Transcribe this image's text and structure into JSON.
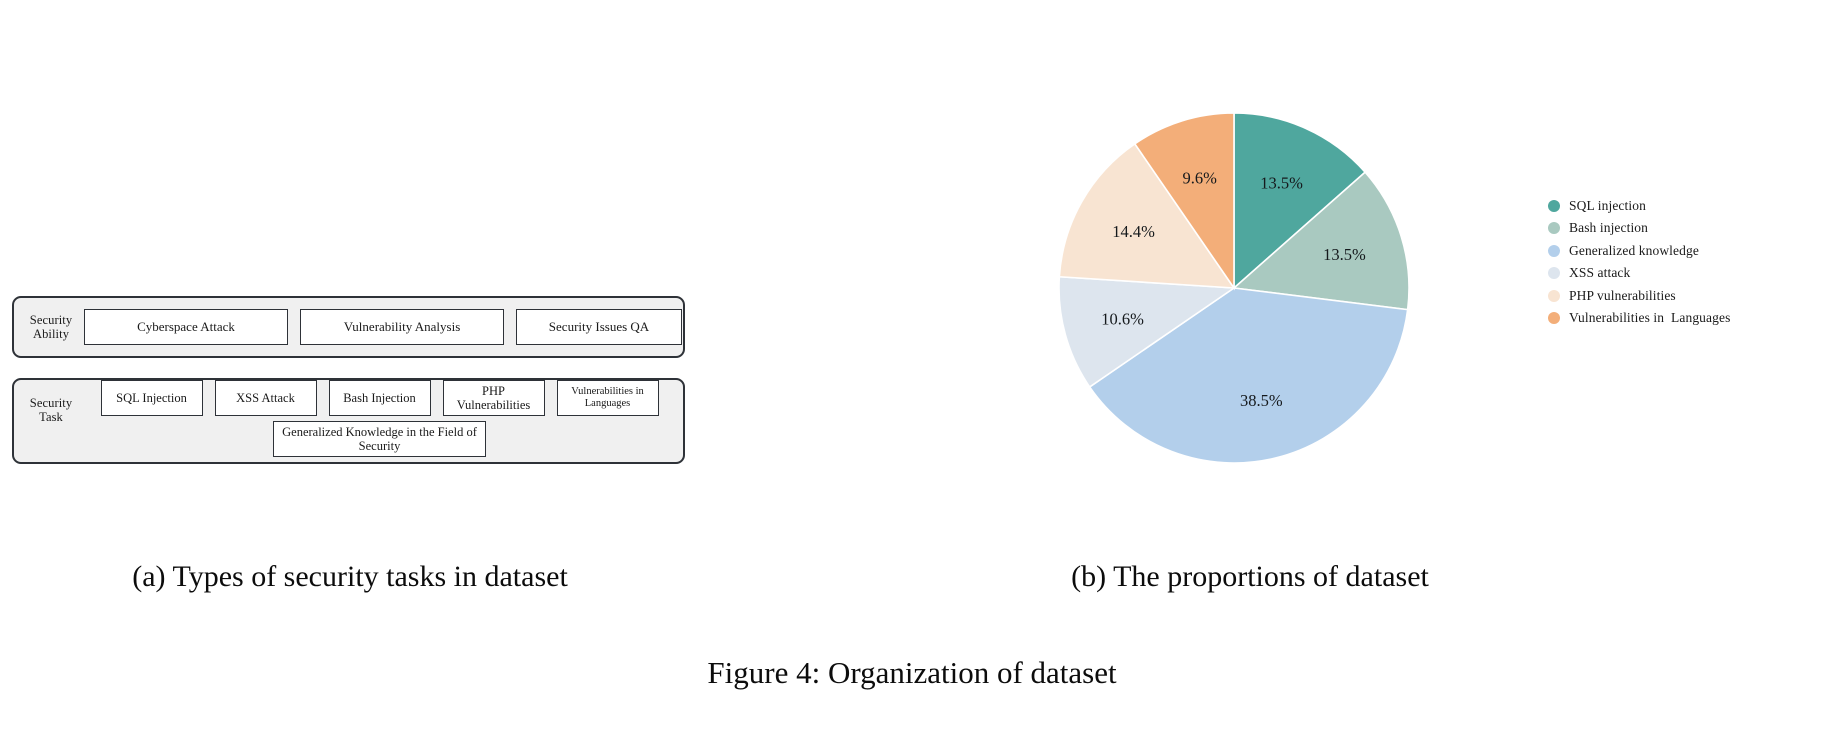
{
  "figure": {
    "caption": "Figure 4: Organization of dataset",
    "subcaption_a": "(a) Types of security tasks in dataset",
    "subcaption_b": "(b) The proportions of dataset"
  },
  "diagram": {
    "groups": [
      {
        "label": "Security\nAbility",
        "label_line1": "Security",
        "label_line2": "Ability",
        "items": [
          "Cyberspace Attack",
          "Vulnerability Analysis",
          "Security Issues QA"
        ]
      },
      {
        "label": "Security\nTask",
        "label_line1": "Security",
        "label_line2": "Task",
        "items": [
          "SQL Injection",
          "XSS Attack",
          "Bash Injection",
          "PHP\nVulnerabilities",
          "Vulnerabilities in\nLanguages",
          "Generalized Knowledge in the\nField of Security"
        ],
        "items_row1": [
          "SQL Injection",
          "XSS Attack",
          "Bash Injection",
          "PHP Vulnerabilities",
          "Vulnerabilities in Languages"
        ],
        "items_row2": [
          "Generalized Knowledge in the Field of Security"
        ]
      }
    ],
    "colors": {
      "panel_background": "#f0f0f0",
      "panel_border": "#2e3238",
      "box_background": "#ffffff",
      "box_border": "#2e3238",
      "text": "#1a1a1a"
    }
  },
  "chart_data": {
    "type": "pie",
    "title": "(b) The proportions of dataset",
    "start_angle_deg": 90,
    "direction": "clockwise",
    "legend_position": "right",
    "grid": false,
    "categories": [
      "SQL injection",
      "Bash injection",
      "Generalized knowledge",
      "XSS attack",
      "PHP vulnerabilities",
      "Vulnerabilities in  Languages"
    ],
    "values": [
      13.5,
      13.5,
      38.5,
      10.6,
      14.4,
      9.6
    ],
    "labels": [
      "13.5%",
      "13.5%",
      "38.5%",
      "10.6%",
      "14.4%",
      "9.6%"
    ],
    "colors": [
      "#4fa79e",
      "#a9c9c0",
      "#b3cfeb",
      "#dde5ee",
      "#f8e4d2",
      "#f3ae79"
    ],
    "units": "percent",
    "slice_label_color": "#15191c",
    "slice_separator_color": "#ffffff"
  },
  "legend": {
    "items": [
      {
        "label": "SQL injection",
        "color": "#4fa79e"
      },
      {
        "label": "Bash injection",
        "color": "#a9c9c0"
      },
      {
        "label": "Generalized knowledge",
        "color": "#b3cfeb"
      },
      {
        "label": "XSS attack",
        "color": "#dde5ee"
      },
      {
        "label": "PHP vulnerabilities",
        "color": "#f8e4d2"
      },
      {
        "label": "Vulnerabilities in  Languages",
        "color": "#f3ae79"
      }
    ]
  }
}
